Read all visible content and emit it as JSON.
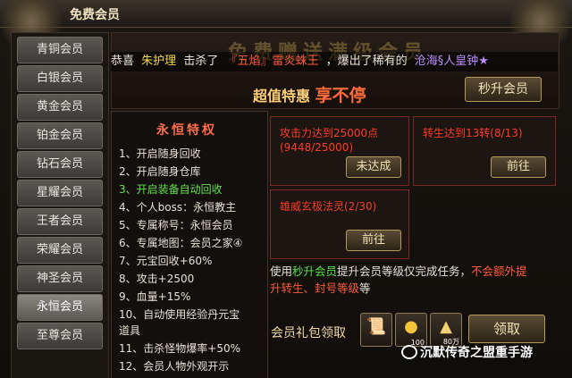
{
  "window": {
    "title": "免费会员"
  },
  "sidebar": {
    "items": [
      {
        "label": "青铜会员"
      },
      {
        "label": "白银会员"
      },
      {
        "label": "黄金会员"
      },
      {
        "label": "铂金会员"
      },
      {
        "label": "钻石会员"
      },
      {
        "label": "星耀会员"
      },
      {
        "label": "王者会员"
      },
      {
        "label": "荣耀会员"
      },
      {
        "label": "神圣会员"
      },
      {
        "label": "永恒会员"
      },
      {
        "label": "至尊会员"
      }
    ],
    "active_index": 9
  },
  "banner": {
    "bg_title": "免费赠送满级会员",
    "ticker": {
      "prefix": "恭喜",
      "player": "朱护理",
      "action": "击杀了",
      "monster": "『五焰』雷炎蛛王",
      "result": "，爆出了稀有的",
      "item": "沧海§人皇钟★"
    },
    "slogan_a": "超值特惠",
    "slogan_b": "享不停",
    "upgrade_button": "秒升会员"
  },
  "privileges": {
    "title": "永恒特权",
    "lines": [
      "1、开启随身回收",
      "2、开启随身仓库",
      "3、开启装备自动回收",
      "4、个人boss：永恒教主",
      "5、专属称号：永恒会员",
      "6、专属地图：会员之家④",
      "7、元宝回收+60%",
      "8、攻击+2500",
      "9、血量+15%",
      "10、自动使用经验丹元宝",
      "道具",
      "11、击杀怪物爆率+50%",
      "12、会员人物外观开示"
    ],
    "highlight_index": 2
  },
  "tasks": [
    {
      "text": "攻击力达到25000点(9448/25000)",
      "button": "未达成"
    },
    {
      "text": "转生达到13转(8/13)",
      "button": "前往"
    },
    {
      "text": "雄威玄极法灵(2/30)",
      "button": "前往"
    }
  ],
  "info": {
    "part1": "使用",
    "link": "秒升会员",
    "part2": "提升会员等级仅完成任务，",
    "warn1": "不会额外提",
    "warn2": "升转生、封号等级",
    "part3": "等"
  },
  "gift": {
    "label": "会员礼包领取",
    "items": [
      {
        "icon": "scroll-icon",
        "count": ""
      },
      {
        "icon": "gold-ingot-icon",
        "count": "100"
      },
      {
        "icon": "silver-ingot-icon",
        "count": "80万"
      }
    ],
    "claim_button": "领取"
  },
  "watermark": "沉默传奇之盟重手游",
  "colors": {
    "accent_red": "#ff3a2a",
    "accent_green": "#62e04a",
    "gold": "#f3d64a"
  }
}
